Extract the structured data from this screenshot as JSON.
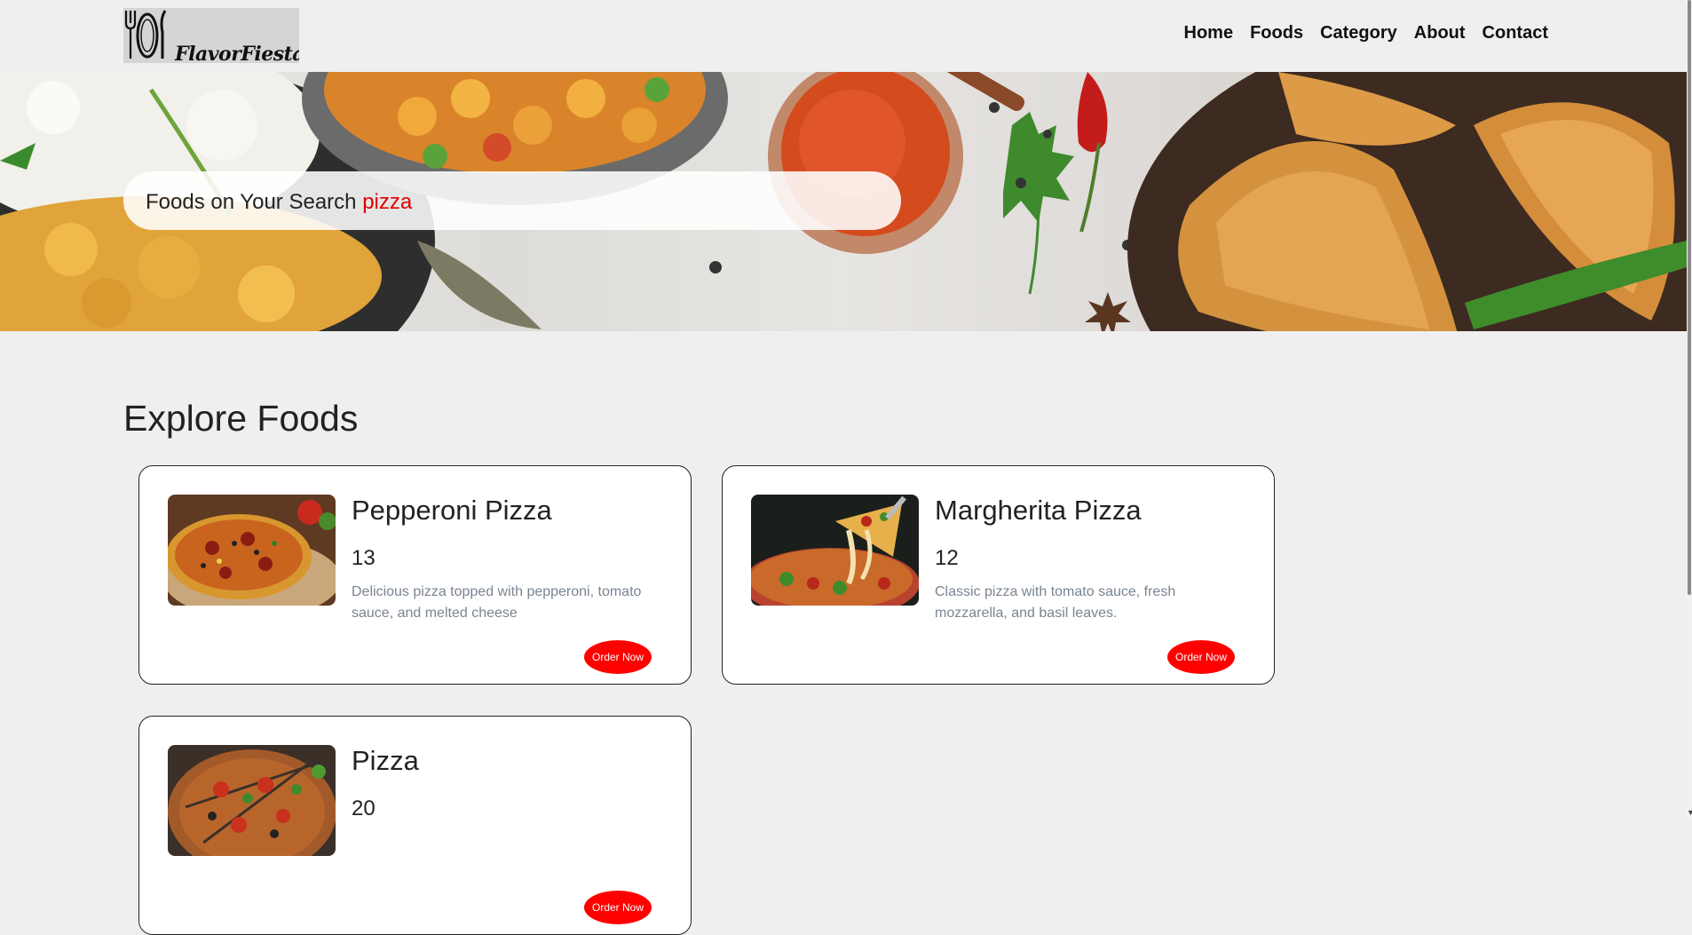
{
  "brand": {
    "name": "FlavorFiesta",
    "logo_icon": "fork-plate-knife-icon"
  },
  "nav": [
    {
      "label": "Home"
    },
    {
      "label": "Foods"
    },
    {
      "label": "Category"
    },
    {
      "label": "About"
    },
    {
      "label": "Contact"
    }
  ],
  "hero": {
    "search_prefix": "Foods on Your Search",
    "search_term": "pizza"
  },
  "main": {
    "title": "Explore Foods",
    "foods": [
      {
        "name": "Pepperoni Pizza",
        "price": "13",
        "description": "Delicious pizza topped with pepperoni, tomato sauce, and melted cheese",
        "button": "Order Now"
      },
      {
        "name": "Margherita Pizza",
        "price": "12",
        "description": "Classic pizza with tomato sauce, fresh mozzarella, and basil leaves.",
        "button": "Order Now"
      },
      {
        "name": "Pizza",
        "price": "20",
        "description": "",
        "button": "Order Now"
      }
    ]
  },
  "colors": {
    "accent": "#ff0000",
    "page_background": "#efefef",
    "card_background": "#ffffff",
    "description_text": "#7a8590"
  }
}
